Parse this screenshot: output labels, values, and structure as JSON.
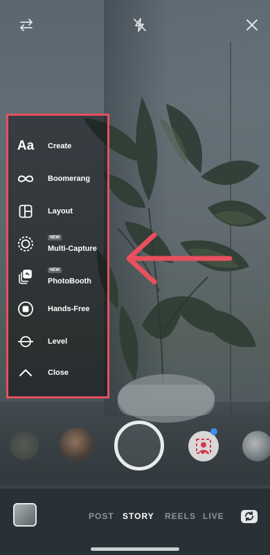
{
  "menu": {
    "items": [
      {
        "id": "create",
        "label": "Create",
        "icon": "text-aa-icon",
        "badge": ""
      },
      {
        "id": "boomerang",
        "label": "Boomerang",
        "icon": "infinity-icon",
        "badge": ""
      },
      {
        "id": "layout",
        "label": "Layout",
        "icon": "layout-grid-icon",
        "badge": ""
      },
      {
        "id": "multi-capture",
        "label": "Multi-Capture",
        "icon": "dotted-circle-icon",
        "badge": "NEW"
      },
      {
        "id": "photobooth",
        "label": "PhotoBooth",
        "icon": "photo-stack-icon",
        "badge": "NEW"
      },
      {
        "id": "hands-free",
        "label": "Hands-Free",
        "icon": "record-circle-icon",
        "badge": ""
      },
      {
        "id": "level",
        "label": "Level",
        "icon": "level-line-icon",
        "badge": ""
      },
      {
        "id": "close",
        "label": "Close",
        "icon": "chevron-up-icon",
        "badge": ""
      }
    ]
  },
  "modes": [
    "POST",
    "STORY",
    "REELS",
    "LIVE"
  ],
  "active_mode": "STORY",
  "colors": {
    "highlight_border": "#e8505e",
    "arrow": "#e8505e",
    "active_mode": "#ffffff",
    "inactive_mode": "#8c9499"
  }
}
